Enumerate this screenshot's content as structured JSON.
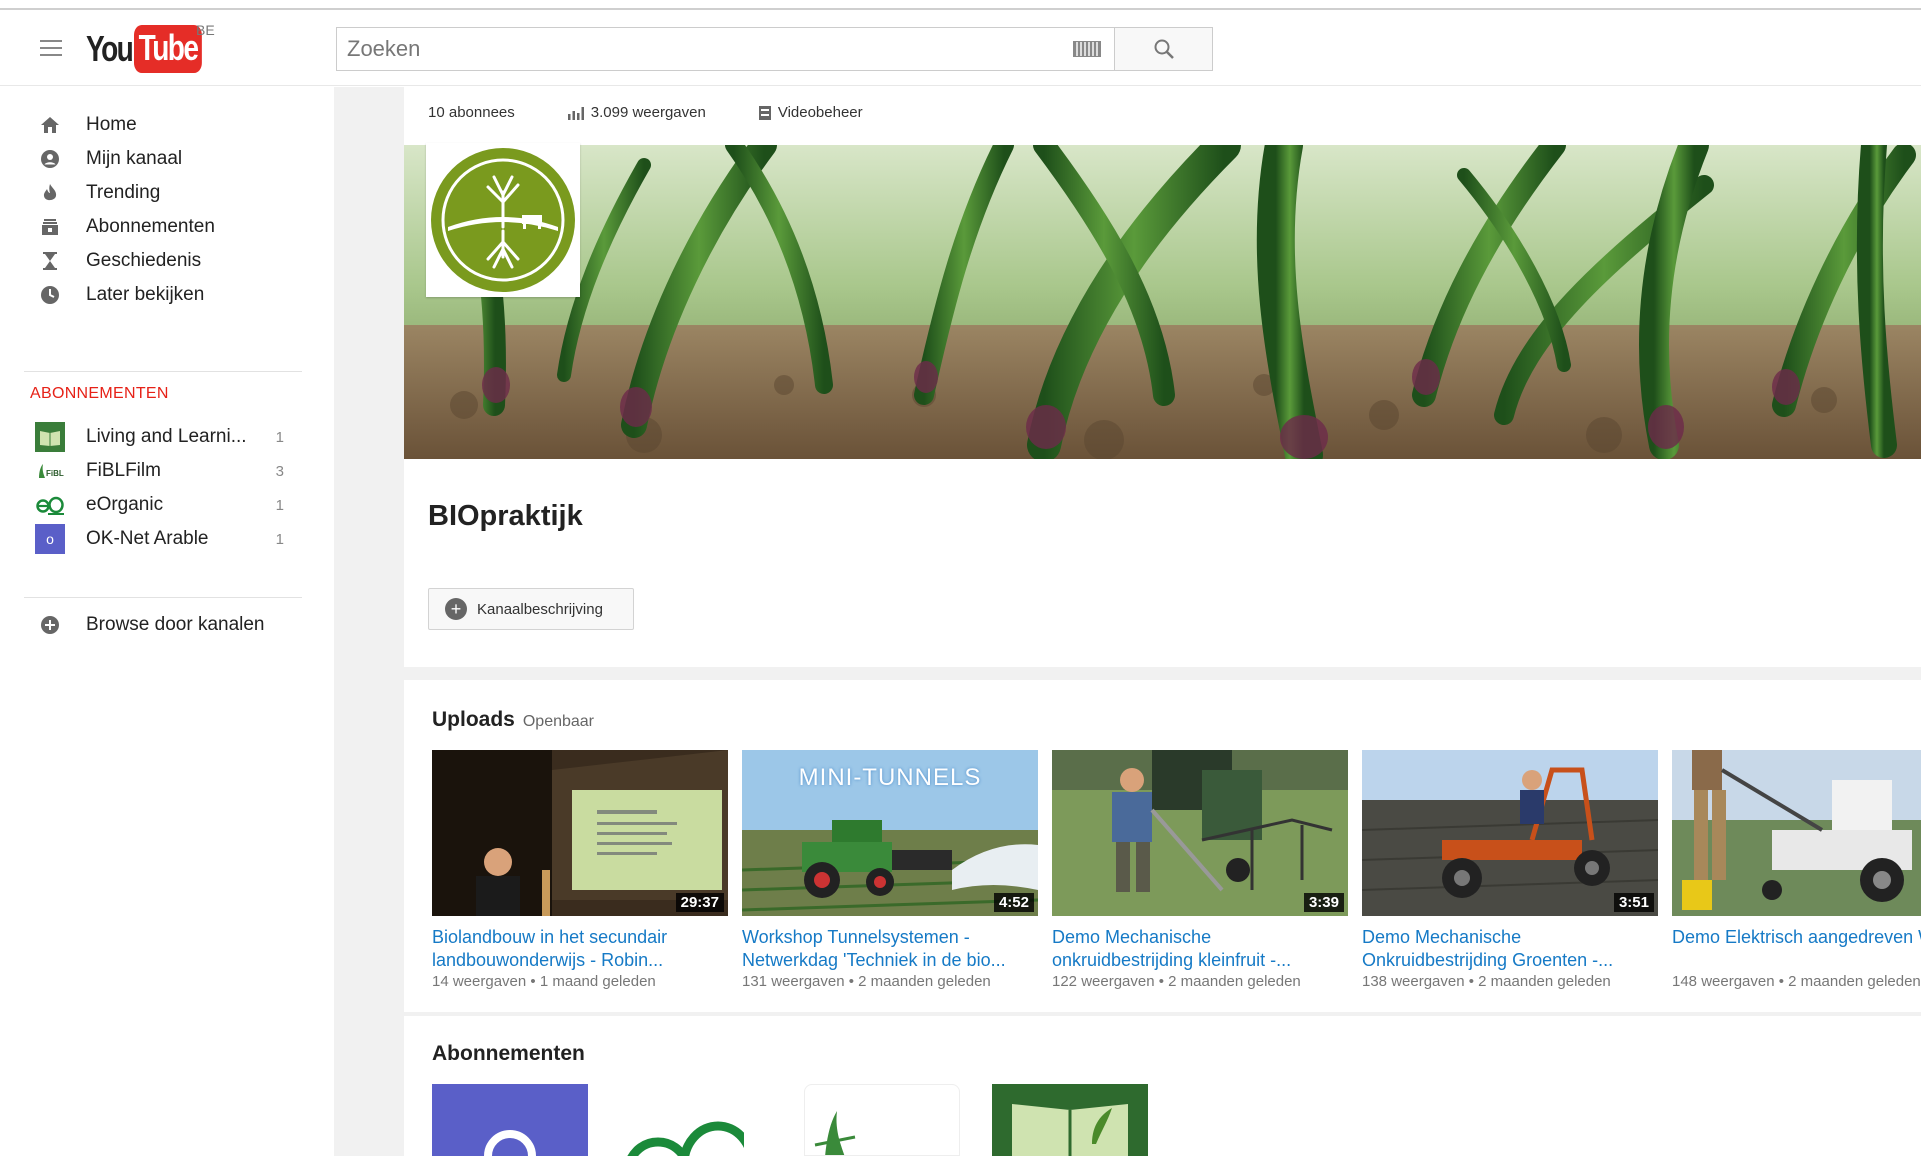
{
  "header": {
    "logo_you": "You",
    "logo_tube": "Tube",
    "region": "BE",
    "search_placeholder": "Zoeken"
  },
  "sidebar": {
    "items": [
      {
        "label": "Home",
        "icon": "home-icon"
      },
      {
        "label": "Mijn kanaal",
        "icon": "account-icon"
      },
      {
        "label": "Trending",
        "icon": "flame-icon"
      },
      {
        "label": "Abonnementen",
        "icon": "subscriptions-icon"
      },
      {
        "label": "Geschiedenis",
        "icon": "hourglass-icon"
      },
      {
        "label": "Later bekijken",
        "icon": "clock-icon"
      }
    ],
    "subs_heading": "ABONNEMENTEN",
    "subscriptions": [
      {
        "label": "Living and Learni...",
        "count": "1"
      },
      {
        "label": "FiBLFilm",
        "count": "3"
      },
      {
        "label": "eOrganic",
        "count": "1"
      },
      {
        "label": "OK-Net Arable",
        "count": "1"
      }
    ],
    "browse_label": "Browse door kanalen"
  },
  "channel": {
    "subscribers": "10 abonnees",
    "views": "3.099 weergaven",
    "manager": "Videobeheer",
    "title": "BIOpraktijk",
    "desc_button": "Kanaalbeschrijving"
  },
  "uploads": {
    "heading": "Uploads",
    "visibility": "Openbaar",
    "videos": [
      {
        "title": "Biolandbouw in het secundair landbouwonderwijs - Robin...",
        "meta": "14 weergaven  •  1 maand geleden",
        "duration": "29:37"
      },
      {
        "title": "Workshop Tunnelsystemen - Netwerkdag 'Techniek in de bio...",
        "meta": "131 weergaven  •  2 maanden geleden",
        "duration": "4:52",
        "overlay": "MINI-TUNNELS"
      },
      {
        "title": "Demo Mechanische onkruidbestrijding kleinfruit -...",
        "meta": "122 weergaven  •  2 maanden geleden",
        "duration": "3:39"
      },
      {
        "title": "Demo Mechanische Onkruidbestrijding Groenten -...",
        "meta": "138 weergaven  •  2 maanden geleden",
        "duration": "3:51"
      },
      {
        "title": "Demo Elektrisch aangedreven Werktuigen - Netwerkdag...",
        "meta": "148 weergaven  •  2 maanden geleden",
        "duration": ""
      }
    ]
  },
  "subscriptions_section": {
    "heading": "Abonnementen"
  },
  "colors": {
    "accent_red": "#e52d27",
    "link_blue": "#167ac6",
    "heading_red": "#e62117"
  }
}
